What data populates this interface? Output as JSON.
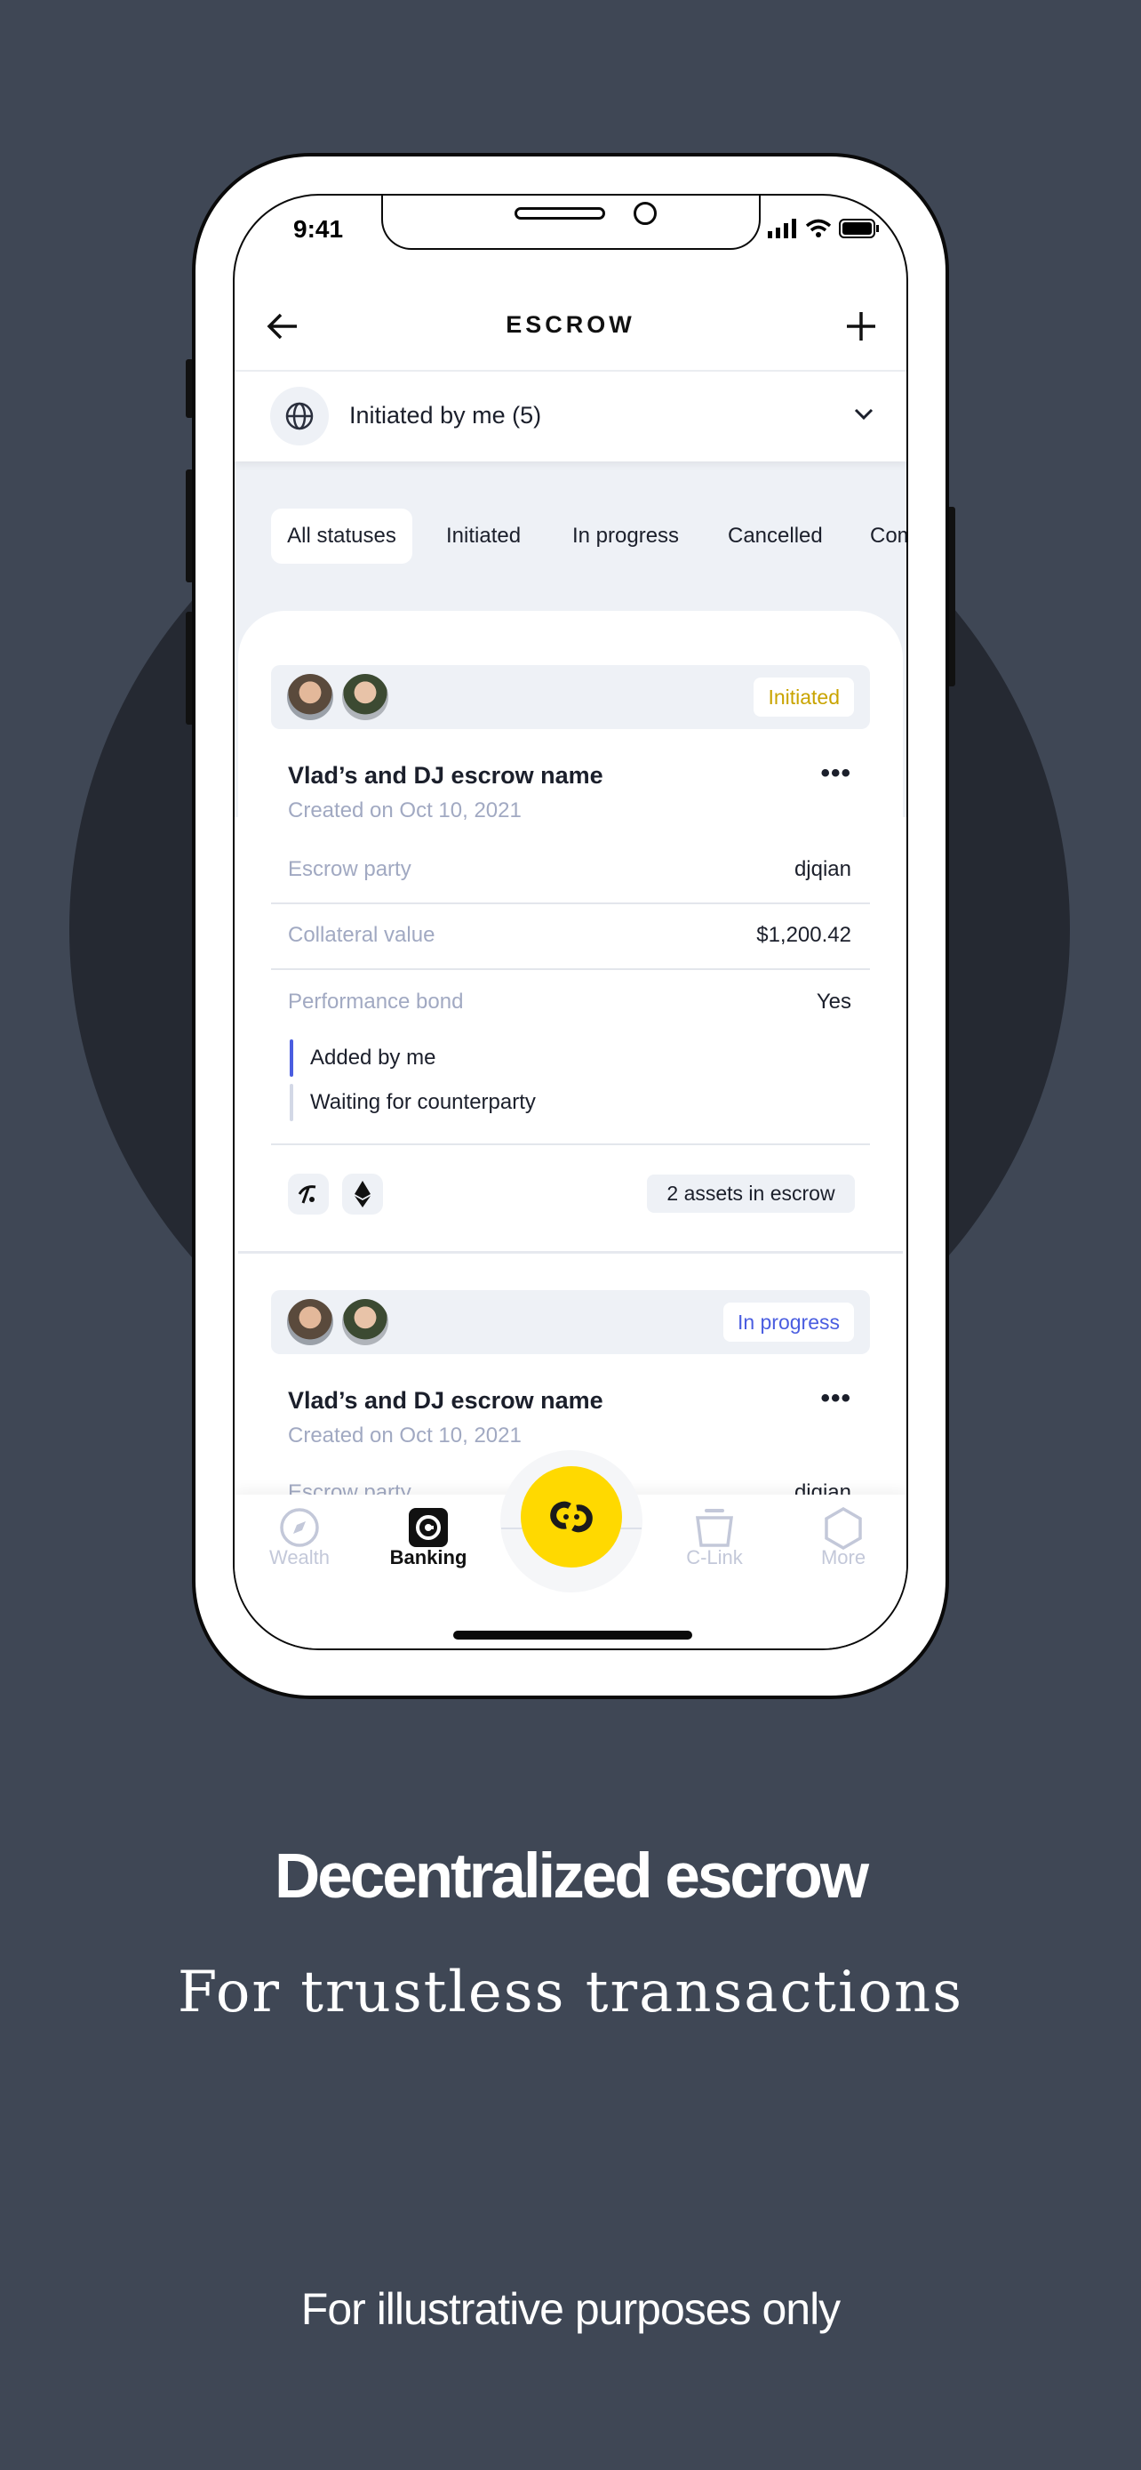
{
  "status_bar": {
    "time": "9:41"
  },
  "header": {
    "title": "ESCROW",
    "back_icon": "arrow-left-icon",
    "add_icon": "plus-icon"
  },
  "filter": {
    "label": "Initiated by me (5)",
    "icon": "globe-icon"
  },
  "status_chips": [
    {
      "label": "All statuses",
      "selected": true
    },
    {
      "label": "Initiated"
    },
    {
      "label": "In progress"
    },
    {
      "label": "Cancelled"
    },
    {
      "label": "Com"
    }
  ],
  "cards": [
    {
      "status": "Initiated",
      "status_color": "#c9a400",
      "title": "Vlad’s and DJ escrow name",
      "created": "Created on Oct 10, 2021",
      "rows": [
        {
          "label": "Escrow party",
          "value": "djqian"
        },
        {
          "label": "Collateral value",
          "value": "$1,200.42"
        },
        {
          "label": "Performance bond",
          "value": "Yes"
        }
      ],
      "steps": [
        "Added by me",
        "Waiting for counterparty"
      ],
      "assets_label": "2 assets in escrow"
    },
    {
      "status": "In progress",
      "status_color": "#4a5de0",
      "title": "Vlad’s and DJ escrow name",
      "created": "Created on Oct 10, 2021",
      "rows": [
        {
          "label": "Escrow party",
          "value": "djqian"
        }
      ]
    }
  ],
  "tabbar": [
    {
      "label": "Wealth",
      "icon": "compass-icon"
    },
    {
      "label": "Banking",
      "icon": "banking-icon",
      "active": true
    },
    {
      "label": "",
      "icon": "link-logo-icon"
    },
    {
      "label": "C-Link",
      "icon": "bucket-icon"
    },
    {
      "label": "More",
      "icon": "hexagon-icon"
    }
  ],
  "promo": {
    "headline": "Decentralized escrow",
    "subheadline": "For trustless transactions",
    "disclaimer": "For illustrative purposes only"
  },
  "colors": {
    "background": "#3f4755",
    "accent_yellow": "#ffd900",
    "accent_blue": "#4a5de0"
  }
}
